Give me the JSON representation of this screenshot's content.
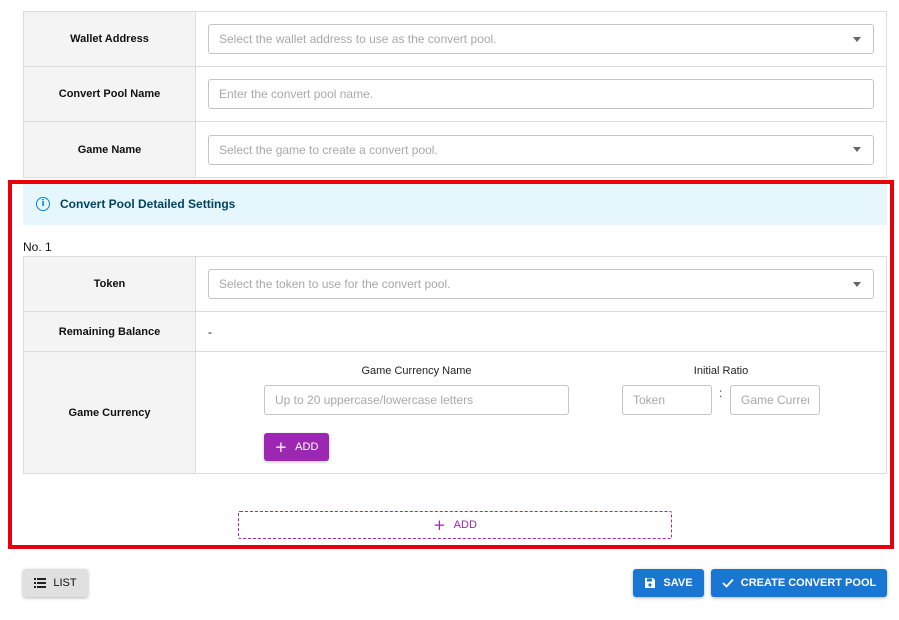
{
  "top_form": {
    "wallet_address": {
      "label": "Wallet Address",
      "placeholder": "Select the wallet address to use as the convert pool."
    },
    "convert_pool_name": {
      "label": "Convert Pool Name",
      "placeholder": "Enter the convert pool name."
    },
    "game_name": {
      "label": "Game Name",
      "placeholder": "Select the game to create a convert pool."
    }
  },
  "detail": {
    "title": "Convert Pool Detailed Settings",
    "info_icon": "info-icon",
    "item_number": "No. 1",
    "token": {
      "label": "Token",
      "placeholder": "Select the token to use for the convert pool."
    },
    "remaining_balance": {
      "label": "Remaining Balance",
      "value": "-"
    },
    "game_currency": {
      "label": "Game Currency",
      "name_header": "Game Currency Name",
      "ratio_header": "Initial Ratio",
      "name_placeholder": "Up to 20 uppercase/lowercase letters",
      "token_placeholder": "Token",
      "ratio_separator": ":",
      "currency_placeholder": "Game Currency",
      "add_label": "ADD"
    },
    "add_item_label": "ADD"
  },
  "footer": {
    "list_label": "LIST",
    "save_label": "SAVE",
    "create_label": "CREATE CONVERT POOL"
  },
  "colors": {
    "primary": "#1976d2",
    "secondary": "#9c27b0",
    "highlight": "#e8000b",
    "info_bg": "#e5f6fd"
  }
}
